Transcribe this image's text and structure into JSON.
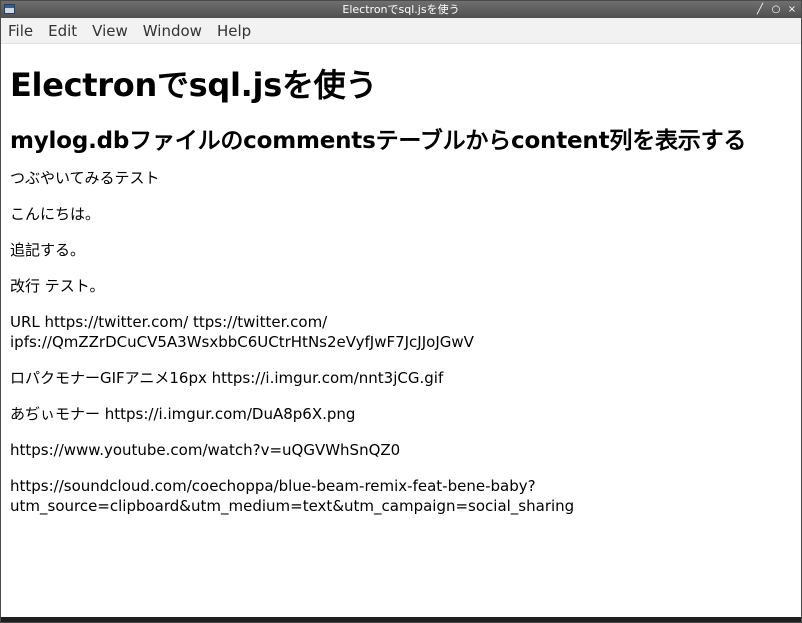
{
  "window": {
    "title": "Electronでsql.jsを使う",
    "controls": [
      "╱",
      "○",
      "×"
    ]
  },
  "menu": {
    "items": [
      "File",
      "Edit",
      "View",
      "Window",
      "Help"
    ]
  },
  "page": {
    "heading": "Electronでsql.jsを使う",
    "subheading": "mylog.dbファイルのcommentsテーブルからcontent列を表示する",
    "comments": [
      "つぶやいてみるテスト",
      "こんにちは。",
      "追記する。",
      "改行 テスト。",
      "URL https://twitter.com/ ttps://twitter.com/\nipfs://QmZZrDCuCV5A3WsxbbC6UCtrHtNs2eVyfJwF7JcJJoJGwV",
      "ロパクモナーGIFアニメ16px https://i.imgur.com/nnt3jCG.gif",
      "あぢぃモナー https://i.imgur.com/DuA8p6X.png",
      "https://www.youtube.com/watch?v=uQGVWhSnQZ0",
      "https://soundcloud.com/coechoppa/blue-beam-remix-feat-bene-baby?\nutm_source=clipboard&utm_medium=text&utm_campaign=social_sharing"
    ]
  }
}
